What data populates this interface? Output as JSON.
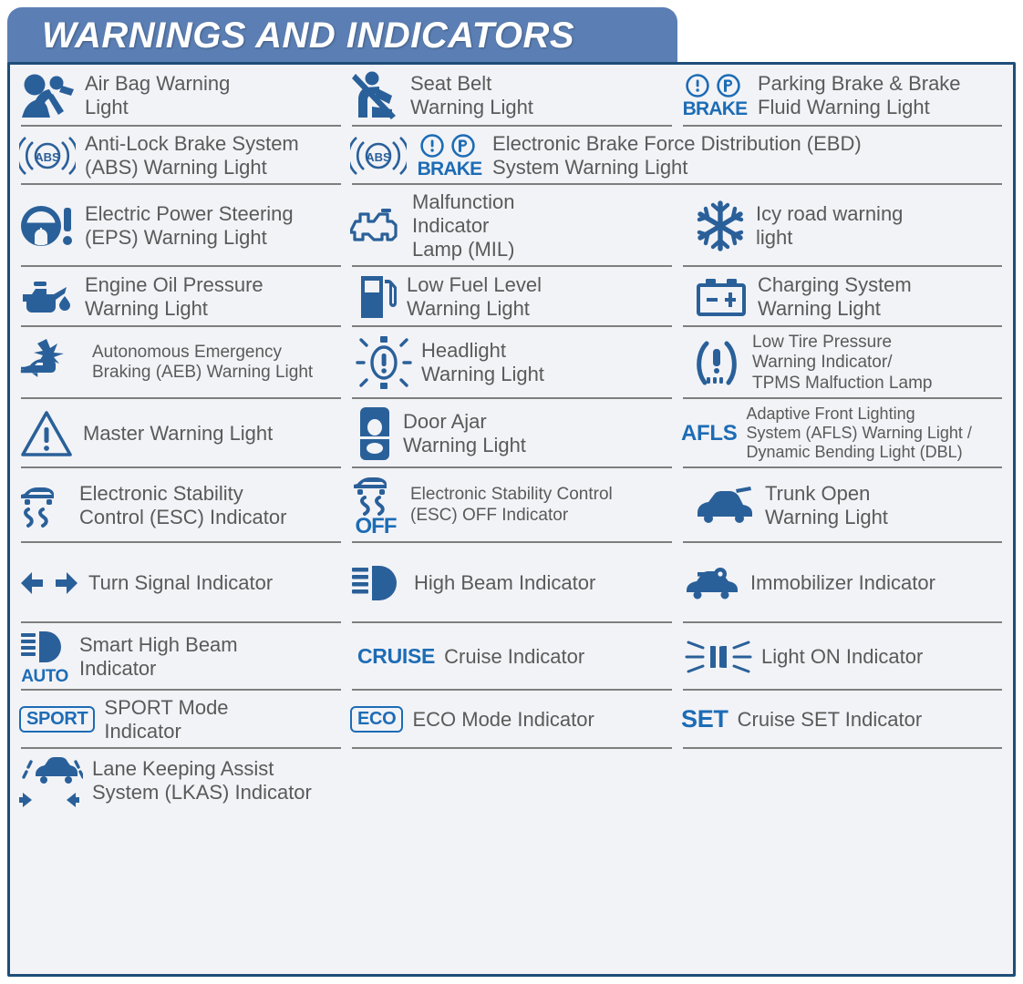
{
  "header": {
    "title": "WARNINGS AND INDICATORS",
    "bar_color": "#5b7fb4",
    "text_color": "#ffffff"
  },
  "theme": {
    "panel_bg": "#f2f3f7",
    "panel_border": "#1f4e79",
    "icon_blue": "#2a6099",
    "accent_blue": "#1d6cb5",
    "label_gray": "#5a5a5a",
    "divider_gray": "#7e7e7e"
  },
  "rows": [
    {
      "cells": [
        {
          "icon": "airbag-icon",
          "label": "Air Bag Warning\nLight"
        },
        {
          "icon": "seat-belt-icon",
          "label": "Seat Belt\nWarning Light"
        },
        {
          "icon": "parking-brake-brake-fluid-icon",
          "icon_text": "BRAKE",
          "label": "Parking Brake & Brake\nFluid Warning Light"
        }
      ]
    },
    {
      "cells": [
        {
          "icon": "abs-icon",
          "icon_text": "ABS",
          "label": "Anti-Lock Brake System\n(ABS) Warning Light"
        },
        {
          "icon": "abs-plus-brake-icon",
          "icon_text": "ABS BRAKE",
          "label": "Electronic Brake Force Distribution (EBD)\nSystem Warning Light",
          "span": 2
        }
      ]
    },
    {
      "cells": [
        {
          "icon": "electric-power-steering-icon",
          "label": "Electric Power Steering\n(EPS) Warning Light"
        },
        {
          "icon": "malfunction-indicator-lamp-icon",
          "label": "Malfunction\nIndicator\nLamp (MIL)"
        },
        {
          "icon": "snowflake-icon",
          "label": "Icy road warning\nlight"
        }
      ]
    },
    {
      "cells": [
        {
          "icon": "oil-can-icon",
          "label": "Engine Oil Pressure\nWarning Light"
        },
        {
          "icon": "fuel-pump-icon",
          "label": "Low Fuel Level\nWarning Light"
        },
        {
          "icon": "battery-icon",
          "label": "Charging System\nWarning Light"
        }
      ]
    },
    {
      "cells": [
        {
          "icon": "autonomous-emergency-braking-icon",
          "label": "Autonomous Emergency\nBraking (AEB) Warning Light"
        },
        {
          "icon": "headlight-warning-icon",
          "label": "Headlight\nWarning Light"
        },
        {
          "icon": "tire-pressure-icon",
          "label": "Low Tire Pressure\nWarning Indicator/\nTPMS Malfuction Lamp"
        }
      ]
    },
    {
      "cells": [
        {
          "icon": "warning-triangle-icon",
          "label": "Master Warning Light"
        },
        {
          "icon": "door-ajar-icon",
          "label": "Door Ajar\nWarning Light"
        },
        {
          "icon": "afls-text-icon",
          "icon_text": "AFLS",
          "label": "Adaptive Front Lighting\nSystem (AFLS) Warning Light /\nDynamic Bending Light (DBL)"
        }
      ]
    },
    {
      "cells": [
        {
          "icon": "esc-icon",
          "label": "Electronic Stability\nControl (ESC) Indicator"
        },
        {
          "icon": "esc-off-icon",
          "icon_text": "OFF",
          "label": "Electronic Stability Control\n(ESC) OFF Indicator"
        },
        {
          "icon": "trunk-open-icon",
          "label": "Trunk Open\nWarning Light"
        }
      ]
    },
    {
      "cells": [
        {
          "icon": "turn-signal-icon",
          "label": "Turn Signal Indicator"
        },
        {
          "icon": "high-beam-icon",
          "label": "High Beam Indicator"
        },
        {
          "icon": "immobilizer-icon",
          "label": "Immobilizer Indicator"
        }
      ]
    },
    {
      "cells": [
        {
          "icon": "smart-high-beam-icon",
          "icon_text": "AUTO",
          "label": "Smart High Beam\nIndicator"
        },
        {
          "icon": "cruise-text-icon",
          "icon_text": "CRUISE",
          "label": "Cruise Indicator"
        },
        {
          "icon": "light-on-icon",
          "label": "Light ON Indicator"
        }
      ]
    },
    {
      "cells": [
        {
          "icon": "sport-mode-icon",
          "icon_text": "SPORT",
          "label": "SPORT Mode\nIndicator"
        },
        {
          "icon": "eco-mode-icon",
          "icon_text": "ECO",
          "label": "ECO Mode Indicator"
        },
        {
          "icon": "cruise-set-icon",
          "icon_text": "SET",
          "label": "Cruise SET Indicator"
        }
      ]
    },
    {
      "cells": [
        {
          "icon": "lane-keeping-assist-icon",
          "label": "Lane Keeping Assist\nSystem (LKAS) Indicator"
        }
      ]
    }
  ]
}
